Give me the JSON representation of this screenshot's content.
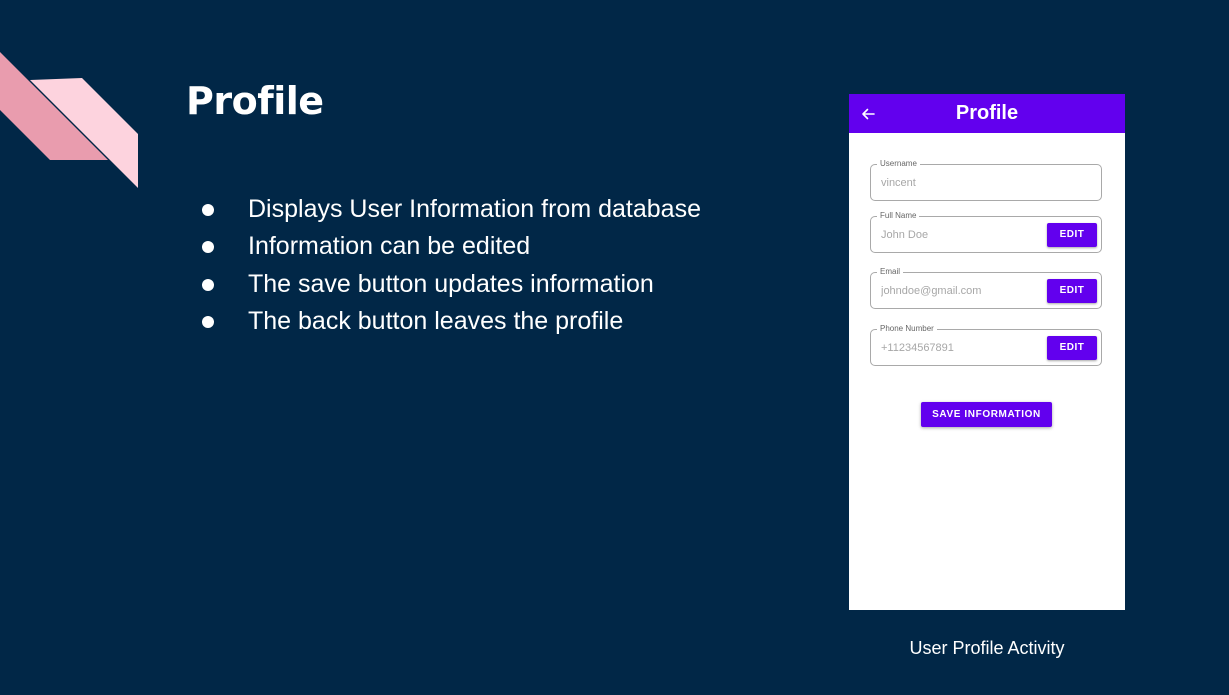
{
  "slide": {
    "title": "Profile",
    "bullets": [
      "Displays User Information from database",
      "Information can be edited",
      "The save button updates information",
      "The back button leaves the profile"
    ],
    "caption": "User Profile Activity"
  },
  "app": {
    "appbar_title": "Profile",
    "fields": [
      {
        "label": "Username",
        "value": "vincent"
      },
      {
        "label": "Full Name",
        "value": "John Doe",
        "button": "EDIT"
      },
      {
        "label": "Email",
        "value": "johndoe@gmail.com",
        "button": "EDIT"
      },
      {
        "label": "Phone Number",
        "value": "+11234567891",
        "button": "EDIT"
      }
    ],
    "save_label": "SAVE INFORMATION"
  },
  "colors": {
    "background": "#012747",
    "accent": "#6200ee",
    "deco_pink_light": "#fdd3de",
    "deco_pink_dark": "#e99cae"
  },
  "icons": {
    "back": "arrow-left-icon"
  }
}
